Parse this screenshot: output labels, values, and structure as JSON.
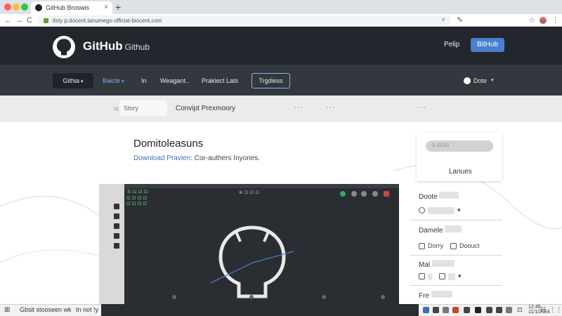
{
  "browser": {
    "tab_title": "GitHub Broswis",
    "tab_close": "×",
    "new_tab": "+",
    "url": "itsty p.docent.tanumego official-biocent.com",
    "back": "←",
    "forward": "→",
    "reload": "C",
    "url_chevron": "∨",
    "star_icon": "☆",
    "menu_icon": "⋮",
    "edit_icon": "✎"
  },
  "header": {
    "brand": "GitHub",
    "brand_sub": "Github",
    "login_label": "Pelip",
    "signup_label": "BitHub"
  },
  "nav": {
    "explore": "Githia",
    "topics": "Baicte",
    "in": "In",
    "widgets": "Weagant..",
    "projects": "Prakiect Lats",
    "teams": "Trgdiess",
    "account": "Dote",
    "chevron": "▾"
  },
  "substrip": {
    "marker": "Is",
    "search": "Story",
    "title": "Convipt Prexmoory",
    "dots": "···"
  },
  "main": {
    "heading": "Domitoleasuns",
    "sub_link": "Download Pravien:",
    "sub_text": " Cor-authers Inyories."
  },
  "screenshot": {
    "tools_line1": "Ⓐ ⊡ ⊡ ⊡",
    "tools_line2": "⊡ ⊡ ⊡ ⊡",
    "tools_line3": "⊡ ⊡ ⊡ ⊡",
    "label": "⊛ ⊡ ⊡ ⊡"
  },
  "sidebar": {
    "card_label": "Lanues",
    "sections": [
      {
        "title": "Doote"
      },
      {
        "title": "Damele"
      },
      {
        "title": "Mal"
      },
      {
        "title": "Fre"
      }
    ],
    "row_dorry": "Dorry",
    "row_doouct": "Doouct"
  },
  "taskbar": {
    "start": "⊞",
    "item1": "Gbsit stooseen wk",
    "item2": "In  not !y",
    "lang": "⊡",
    "clock_time": "12:45",
    "clock_date": "11/1/2024",
    "notify": "☷",
    "dots": "⋮⋮"
  },
  "colors": {
    "header_bg": "#23272d",
    "nav_bg": "#33383f",
    "accent": "#4a7fcf",
    "link": "#3d72b4"
  }
}
